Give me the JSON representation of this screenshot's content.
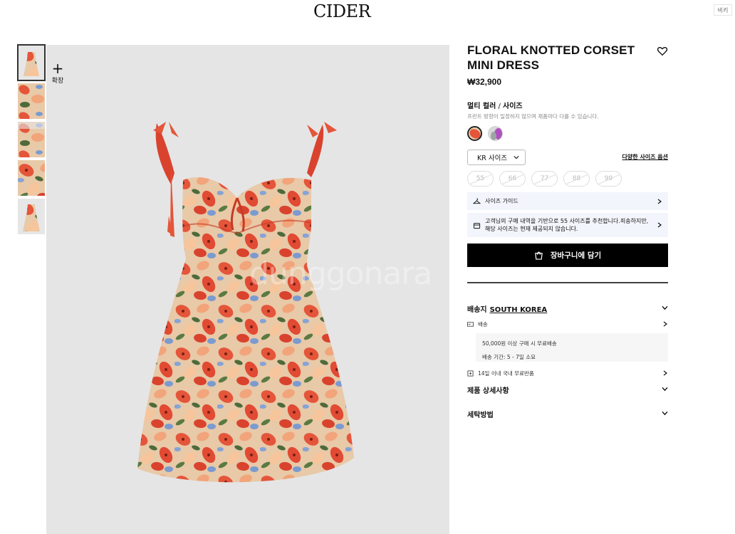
{
  "header": {
    "logo": "CIDER",
    "corner_tab": "비키"
  },
  "gallery": {
    "zoom_label": "확장",
    "watermark": "dunggonara",
    "thumbnails": [
      "thumb-1",
      "thumb-2",
      "thumb-3",
      "thumb-4",
      "thumb-5"
    ]
  },
  "product": {
    "title": "FLORAL KNOTTED CORSET MINI DRESS",
    "price": "₩32,900",
    "color_label": "멀티 컬러",
    "sep": " / ",
    "size_label": "사이즈",
    "color_note": "프린트 방향이 일정하지 않으며 제품마다 다를 수 있습니다.",
    "swatches": [
      "multi-floral",
      "lilac-floral"
    ],
    "size_select": "KR 사이즈",
    "size_link": "다양한 사이즈 옵션",
    "sizes": [
      "55",
      "66",
      "77",
      "88",
      "99"
    ],
    "size_guide": "사이즈 가이드",
    "recommendation": "고객님의 구매 내역을 기반으로 55 사이즈를 추천합니다.죄송하지만, 해당 사이즈는 현재 제공되지 않습니다.",
    "cart_button": "장바구니에 담기"
  },
  "shipping": {
    "label": "배송지",
    "country": "SOUTH KOREA",
    "delivery": "배송",
    "free_note": "50,000원 이상 구매 시 무료배송",
    "period": "배송 기간: 5 - 7일 소요",
    "returns": "14일 이내 국내 무료반품"
  },
  "sections": {
    "details": "제품 상세사항",
    "care": "세탁방법"
  },
  "colors": {
    "accent": "#000000",
    "guide_bg": "#f2f5fb",
    "image_bg": "#e5e5e5"
  }
}
